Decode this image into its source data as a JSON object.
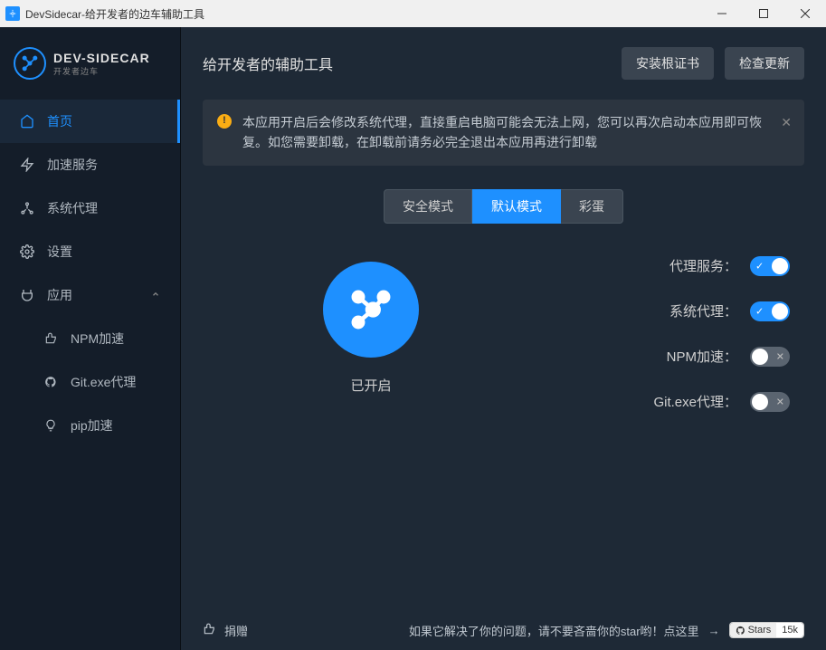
{
  "window": {
    "title": "DevSidecar-给开发者的边车辅助工具"
  },
  "logo": {
    "title": "DEV-SIDECAR",
    "sub": "开发者边车"
  },
  "sidebar": {
    "items": [
      {
        "label": "首页"
      },
      {
        "label": "加速服务"
      },
      {
        "label": "系统代理"
      },
      {
        "label": "设置"
      },
      {
        "label": "应用"
      },
      {
        "label": "NPM加速"
      },
      {
        "label": "Git.exe代理"
      },
      {
        "label": "pip加速"
      }
    ]
  },
  "header": {
    "title": "给开发者的辅助工具",
    "install_cert": "安装根证书",
    "check_update": "检查更新"
  },
  "alert": {
    "text": "本应用开启后会修改系统代理，直接重启电脑可能会无法上网，您可以再次启动本应用即可恢复。如您需要卸载，在卸载前请务必完全退出本应用再进行卸载"
  },
  "modes": {
    "safe": "安全模式",
    "default": "默认模式",
    "egg": "彩蛋"
  },
  "status": {
    "label": "已开启"
  },
  "switches": {
    "proxy_service": {
      "label": "代理服务：",
      "on": true
    },
    "system_proxy": {
      "label": "系统代理：",
      "on": true
    },
    "npm": {
      "label": "NPM加速：",
      "on": false
    },
    "git": {
      "label": "Git.exe代理：",
      "on": false
    }
  },
  "footer": {
    "donate": "捐赠",
    "star_text": "如果它解决了你的问题，请不要吝啬你的star哟！点这里",
    "badge_stars": "Stars",
    "badge_count": "15k"
  }
}
